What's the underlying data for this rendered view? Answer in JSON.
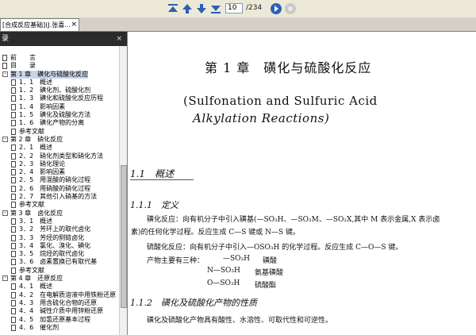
{
  "toolbar": {
    "page_current": "10",
    "page_total": "/234"
  },
  "tab": {
    "title": "[合成反应基础](J.张喜...",
    "close": "×"
  },
  "sidebar": {
    "header": "录",
    "close": "×",
    "items": [
      {
        "level": 0,
        "expander": "",
        "text": "前　　言"
      },
      {
        "level": 0,
        "expander": "",
        "text": "目　　录"
      },
      {
        "level": 0,
        "expander": "-",
        "text": "第 1 章　磺化与硫酸化反应",
        "selected": true
      },
      {
        "level": 1,
        "expander": "",
        "text": "1．1　概述"
      },
      {
        "level": 1,
        "expander": "",
        "text": "1．2　磺化剂、硫酸化剂"
      },
      {
        "level": 1,
        "expander": "",
        "text": "1．3　磺化和硫酸化反应历程"
      },
      {
        "level": 1,
        "expander": "",
        "text": "1．4　影响因素"
      },
      {
        "level": 1,
        "expander": "",
        "text": "1．5　磺化及硫酸化方法"
      },
      {
        "level": 1,
        "expander": "",
        "text": "1．6　磺化产物的分离"
      },
      {
        "level": 1,
        "expander": "",
        "text": "参考文献"
      },
      {
        "level": 0,
        "expander": "-",
        "text": "第 2 章　硝化反应"
      },
      {
        "level": 1,
        "expander": "",
        "text": "2．1　概述"
      },
      {
        "level": 1,
        "expander": "",
        "text": "2．2　硝化剂类型和硝化方法"
      },
      {
        "level": 1,
        "expander": "",
        "text": "2．3　硝化理论"
      },
      {
        "level": 1,
        "expander": "",
        "text": "2．4　影响因素"
      },
      {
        "level": 1,
        "expander": "",
        "text": "2．5　用混酸的硝化过程"
      },
      {
        "level": 1,
        "expander": "",
        "text": "2．6　用硝酸的硝化过程"
      },
      {
        "level": 1,
        "expander": "",
        "text": "2．7　其他引入硝基的方法"
      },
      {
        "level": 1,
        "expander": "",
        "text": "参考文献"
      },
      {
        "level": 0,
        "expander": "-",
        "text": "第 3 章　卤化反应"
      },
      {
        "level": 1,
        "expander": "",
        "text": "3．1　概述"
      },
      {
        "level": 1,
        "expander": "",
        "text": "3．2　芳环上的取代卤化"
      },
      {
        "level": 1,
        "expander": "",
        "text": "3．3　芳烃的侧链卤化"
      },
      {
        "level": 1,
        "expander": "",
        "text": "3．4　氯化、溴化、碘化"
      },
      {
        "level": 1,
        "expander": "",
        "text": "3．5　烷烃的取代卤化"
      },
      {
        "level": 1,
        "expander": "",
        "text": "3．6　卤素置换已有取代基"
      },
      {
        "level": 1,
        "expander": "",
        "text": "参考文献"
      },
      {
        "level": 0,
        "expander": "-",
        "text": "第 4 章　还原反应"
      },
      {
        "level": 1,
        "expander": "",
        "text": "4．1　概述"
      },
      {
        "level": 1,
        "expander": "",
        "text": "4．2　在电解质溶液中用铁粉还原"
      },
      {
        "level": 1,
        "expander": "",
        "text": "4．3　用含硫化合物的还原"
      },
      {
        "level": 1,
        "expander": "",
        "text": "4．4　碱性介质中用锌粉还原"
      },
      {
        "level": 1,
        "expander": "",
        "text": "4．5　加氢还原基本过程"
      },
      {
        "level": 1,
        "expander": "",
        "text": "4．6　催化剂"
      }
    ]
  },
  "document": {
    "chapter_title": "第 1 章　磺化与硫酸化反应",
    "chapter_en_1": "(Sulfonation and Sulfuric Acid",
    "chapter_en_2": "Alkylation Reactions)",
    "section_1": "1.1　概述",
    "subsection_1_1": "1.1.1　定义",
    "para_1": "磺化反应：向有机分子中引入磺基(—SO₃H、—SO₃M、—SO₂X,其中 M 表示金属,X 表示卤",
    "para_1b": "素)的任何化学过程。反应生成 C—S 键或 N—S 键。",
    "para_2": "硫酸化反应：向有机分子中引入—OSO₃H 的化学过程。反应生成 C—O—S 键。",
    "para_3_label": "产物主要有三种：",
    "product_1_formula": "—SO₃H",
    "product_1_name": "磺酸",
    "product_2_formula": "N—SO₃H",
    "product_2_name": "氨基磺酸",
    "product_3_formula": "O—SO₃H",
    "product_3_name": "硫酸酯",
    "subsection_1_2": "1.1.2　磺化及硫酸化产物的性质",
    "para_4": "磺化及硫酸化产物具有酸性、水溶性、可取代性和可逆性。"
  },
  "colors": {
    "toolbar_icon": "#2f5fb3",
    "toolbar_bg": "#ece9d8",
    "sidebar_header": "#2b2b2b",
    "selection": "#c8d4e8"
  }
}
